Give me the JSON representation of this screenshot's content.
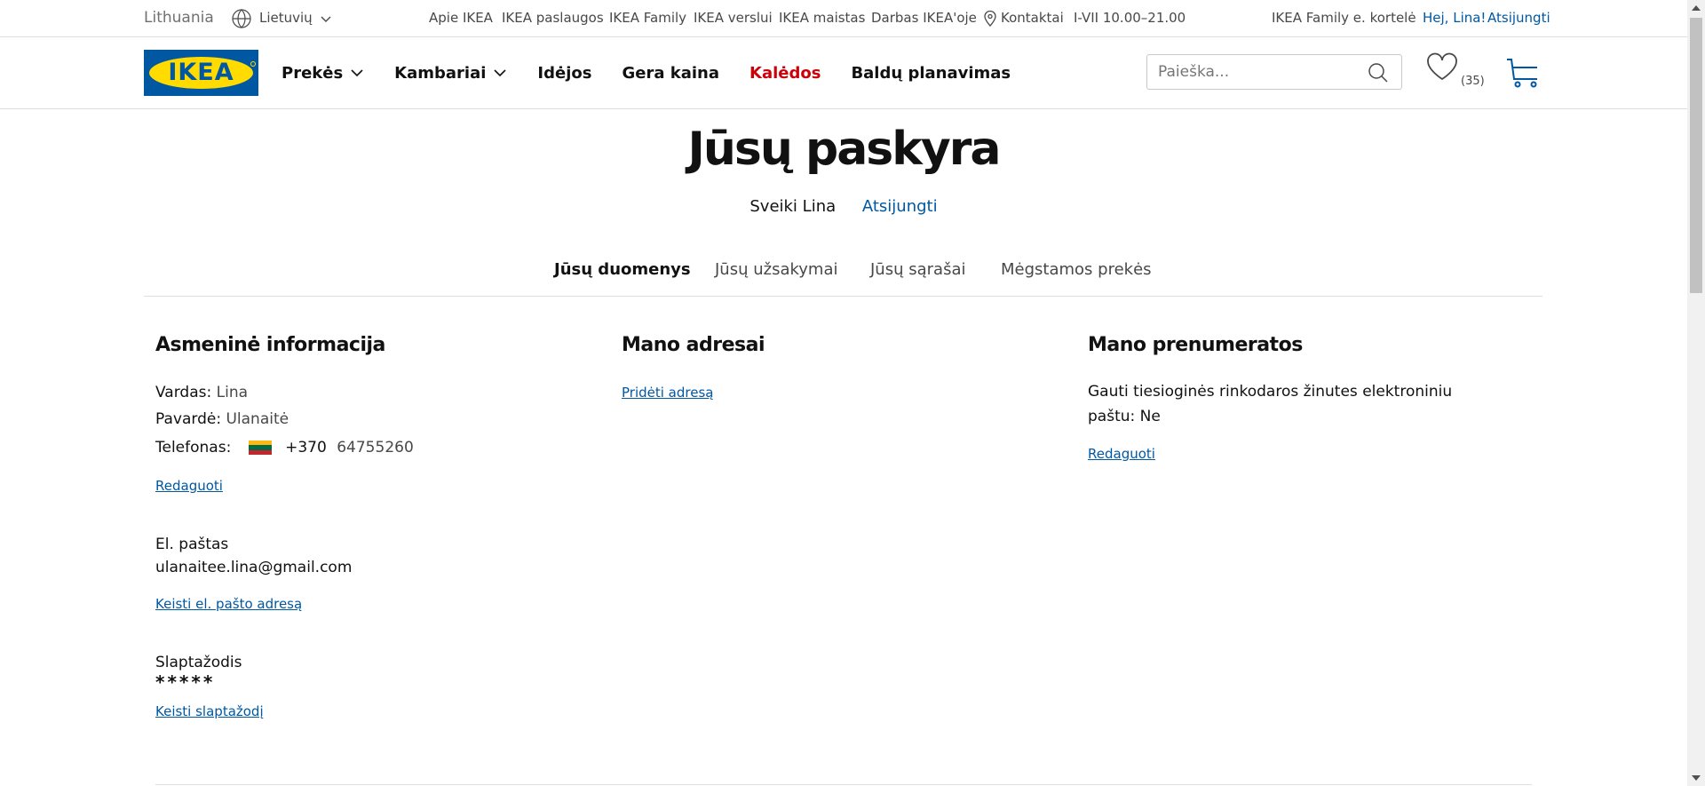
{
  "utility": {
    "country": "Lithuania",
    "language": "Lietuvių",
    "links": [
      "Apie IKEA",
      "IKEA paslaugos",
      "IKEA Family",
      "IKEA verslui",
      "IKEA maistas",
      "Darbas IKEA'oje"
    ],
    "contacts": "Kontaktai",
    "hours": "I-VII 10.00–21.00",
    "family_card": "IKEA Family e. kortelė",
    "greeting": "Hej, Lina!",
    "logout": "Atsijungti"
  },
  "header": {
    "logo_text": "IKEA",
    "nav": [
      {
        "label": "Prekės",
        "dropdown": true
      },
      {
        "label": "Kambariai",
        "dropdown": true
      },
      {
        "label": "Idėjos",
        "dropdown": false
      },
      {
        "label": "Gera kaina",
        "dropdown": false
      },
      {
        "label": "Kalėdos",
        "dropdown": false,
        "highlight": "#cc0008"
      },
      {
        "label": "Baldų planavimas",
        "dropdown": false
      }
    ],
    "search_placeholder": "Paieška...",
    "wishlist_count": "(35)"
  },
  "page": {
    "title": "Jūsų paskyra",
    "greeting": "Sveiki Lina",
    "logout": "Atsijungti"
  },
  "tabs": [
    "Jūsų duomenys",
    "Jūsų užsakymai",
    "Jūsų sąrašai",
    "Mėgstamos prekės"
  ],
  "active_tab": "Jūsų duomenys",
  "personal": {
    "heading": "Asmeninė informacija",
    "first_name_label": "Vardas:",
    "first_name": "Lina",
    "last_name_label": "Pavardė:",
    "last_name": "Ulanaitė",
    "phone_label": "Telefonas:",
    "phone_code": "+370",
    "phone_number": "64755260",
    "edit": "Redaguoti",
    "email_label": "El. paštas",
    "email": "ulanaitee.lina@gmail.com",
    "change_email": "Keisti el. pašto adresą",
    "password_label": "Slaptažodis",
    "password_mask": "*****",
    "change_password": "Keisti slaptažodį"
  },
  "addresses": {
    "heading": "Mano adresai",
    "add": "Pridėti adresą"
  },
  "subscriptions": {
    "heading": "Mano prenumeratos",
    "text": "Gauti tiesioginės rinkodaros žinutes elektroniniu paštu:",
    "value": "Ne",
    "edit": "Redaguoti"
  },
  "colors": {
    "brand_blue": "#0058a3",
    "brand_yellow": "#ffdb00",
    "highlight_red": "#cc0008",
    "link": "#0058a3"
  }
}
